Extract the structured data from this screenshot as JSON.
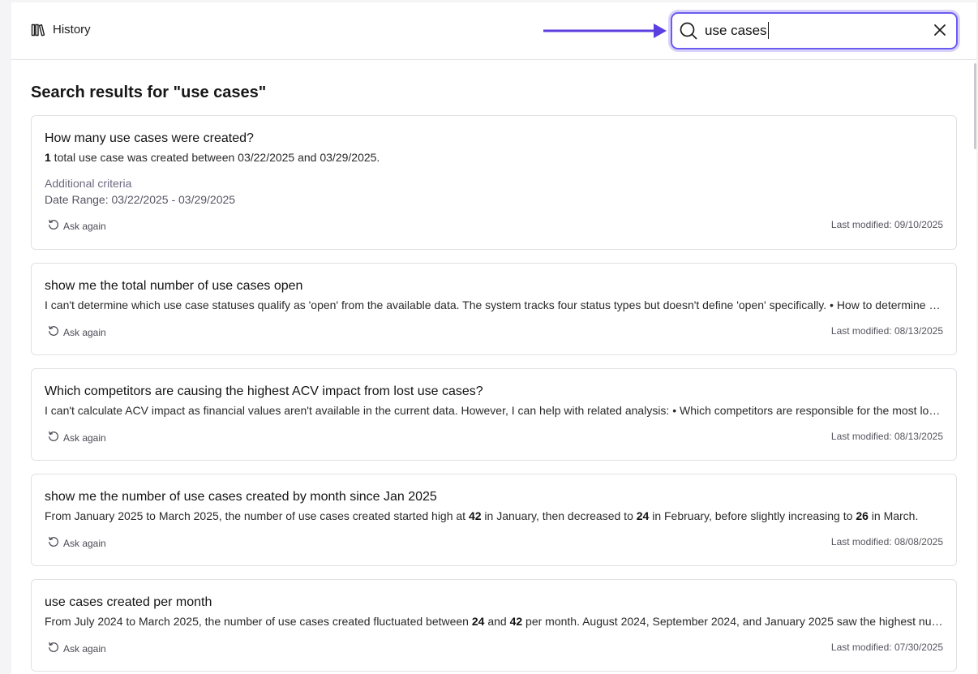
{
  "header": {
    "title": "History",
    "title_icon": "library-icon",
    "search": {
      "value": "use cases",
      "search_icon": "search-icon",
      "clear_icon": "close-icon"
    },
    "accent_color": "#5b3fe0"
  },
  "results": {
    "heading": "Search results for \"use cases\"",
    "ask_again_label": "Ask again",
    "modified_prefix": "Last modified: ",
    "items": [
      {
        "title": "How many use cases were created?",
        "body": [
          {
            "bold": true,
            "text": "1"
          },
          {
            "bold": false,
            "text": " total use case was created between 03/22/2025 and 03/29/2025."
          }
        ],
        "criteria_label": "Additional criteria",
        "criteria_range": "Date Range:  03/22/2025 - 03/29/2025",
        "modified": "09/10/2025"
      },
      {
        "title": "show me the total number of use cases open",
        "body": [
          {
            "bold": false,
            "text": "I can't determine which use case statuses qualify as 'open' from the available data. The system tracks four status types but doesn't define 'open' specifically. • How to determine which statuses are open"
          }
        ],
        "modified": "08/13/2025"
      },
      {
        "title": "Which competitors are causing the highest ACV impact from lost use cases?",
        "body": [
          {
            "bold": false,
            "text": "I can't calculate ACV impact as financial values aren't available in the current data. However, I can help with related analysis: • Which competitors are responsible for the most lost use cases"
          }
        ],
        "modified": "08/13/2025"
      },
      {
        "title": "show me the number of use cases created by month since Jan 2025",
        "body": [
          {
            "bold": false,
            "text": "From January 2025 to March 2025, the number of use cases created started high at "
          },
          {
            "bold": true,
            "text": "42"
          },
          {
            "bold": false,
            "text": " in January, then decreased to "
          },
          {
            "bold": true,
            "text": "24"
          },
          {
            "bold": false,
            "text": " in February, before slightly increasing to "
          },
          {
            "bold": true,
            "text": "26"
          },
          {
            "bold": false,
            "text": " in March."
          }
        ],
        "modified": "08/08/2025"
      },
      {
        "title": "use cases created per month",
        "body": [
          {
            "bold": false,
            "text": "From July 2024 to March 2025, the number of use cases created fluctuated between "
          },
          {
            "bold": true,
            "text": "24"
          },
          {
            "bold": false,
            "text": " and "
          },
          {
            "bold": true,
            "text": "42"
          },
          {
            "bold": false,
            "text": " per month. August 2024, September 2024, and January 2025 saw the highest numbers."
          }
        ],
        "modified": "07/30/2025"
      }
    ]
  }
}
